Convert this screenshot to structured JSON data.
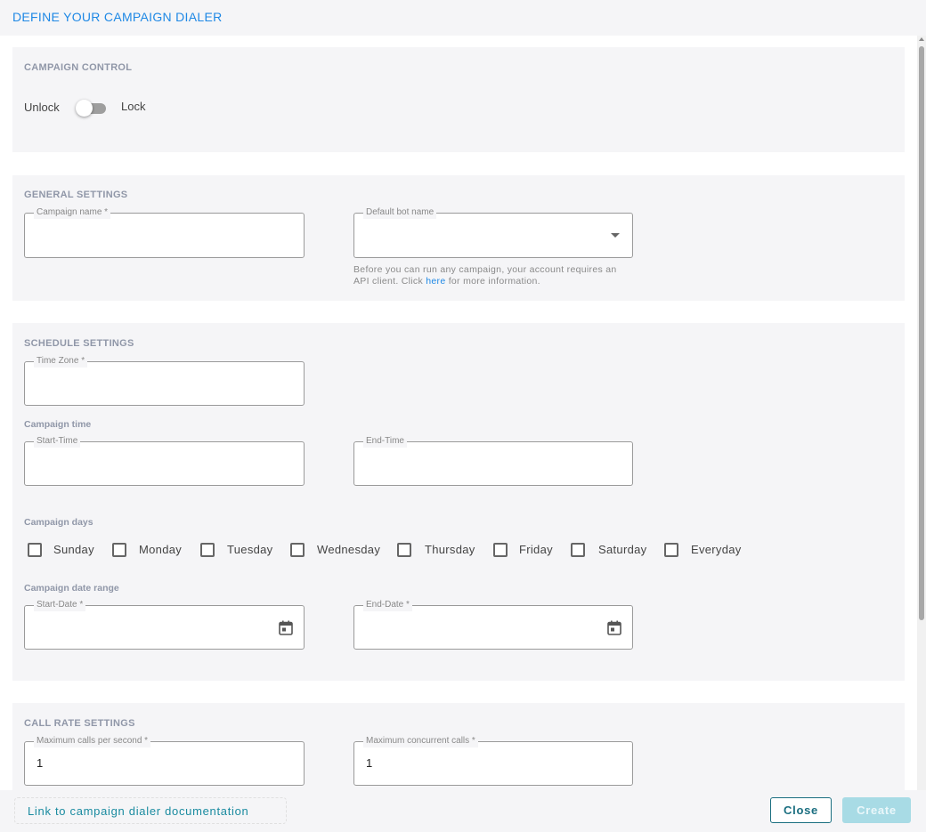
{
  "header": {
    "title": "DEFINE YOUR CAMPAIGN DIALER"
  },
  "campaign_control": {
    "title": "CAMPAIGN CONTROL",
    "unlock_label": "Unlock",
    "lock_label": "Lock",
    "locked": false
  },
  "general_settings": {
    "title": "GENERAL SETTINGS",
    "campaign_name_label": "Campaign name *",
    "campaign_name_value": "",
    "bot_name_label": "Default bot name",
    "bot_name_value": "",
    "helper_line1": "Before you can run any campaign, your account requires an",
    "helper_line2_prefix": "API client. Click ",
    "helper_link": "here",
    "helper_line2_suffix": " for more information."
  },
  "schedule_settings": {
    "title": "SCHEDULE SETTINGS",
    "timezone_label": "Time Zone *",
    "timezone_value": "",
    "campaign_time_label": "Campaign time",
    "start_time_label": "Start-Time",
    "start_time_value": "",
    "end_time_label": "End-Time",
    "end_time_value": "",
    "campaign_days_label": "Campaign days",
    "days": [
      "Sunday",
      "Monday",
      "Tuesday",
      "Wednesday",
      "Thursday",
      "Friday",
      "Saturday",
      "Everyday"
    ],
    "date_range_label": "Campaign date range",
    "start_date_label": "Start-Date *",
    "start_date_value": "",
    "end_date_label": "End-Date *",
    "end_date_value": ""
  },
  "call_rate_settings": {
    "title": "CALL RATE SETTINGS",
    "max_cps_label": "Maximum calls per second *",
    "max_cps_value": "1",
    "max_concurrent_label": "Maximum concurrent calls *",
    "max_concurrent_value": "1"
  },
  "footer": {
    "doc_link": "Link to campaign dialer documentation",
    "close_label": "Close",
    "create_label": "Create"
  },
  "icons": {
    "dropdown": "caret-down-icon",
    "calendar": "calendar-icon"
  },
  "colors": {
    "accent": "#1e88e5",
    "primary_button": "#1a6e80",
    "disabled_button": "#a8dbe5"
  }
}
